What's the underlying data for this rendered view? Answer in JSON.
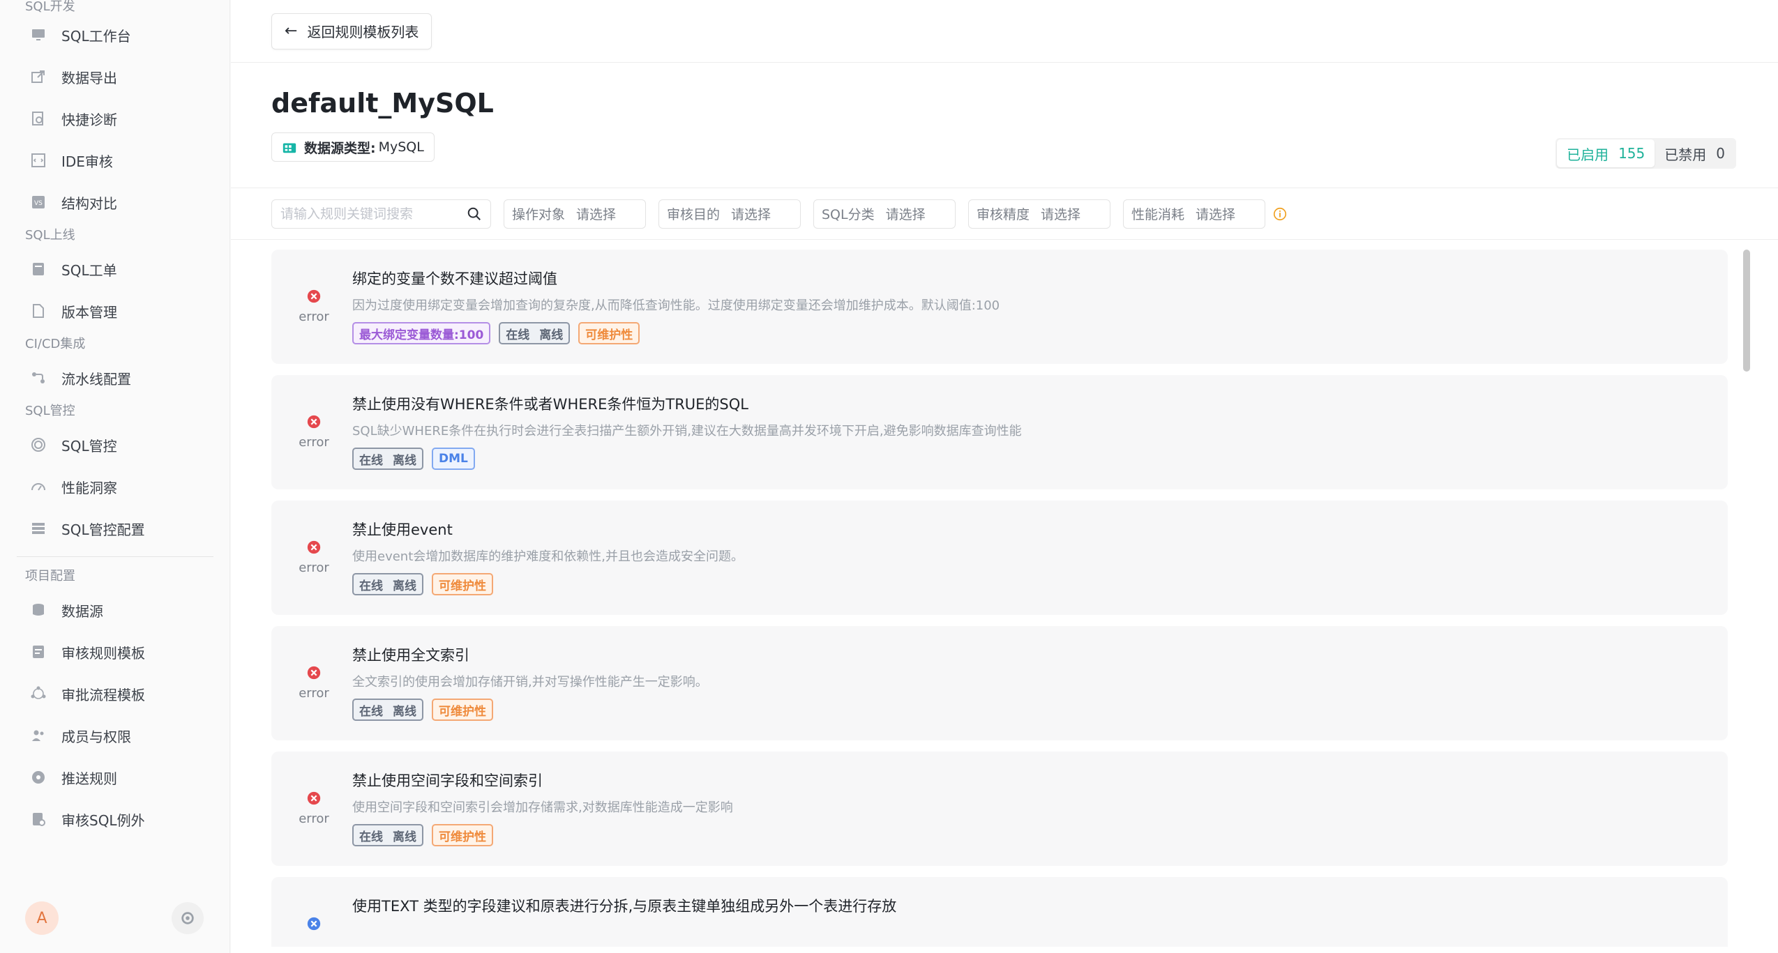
{
  "sidebar": {
    "groups": [
      {
        "title": "SQL开发",
        "items": [
          {
            "label": "SQL工作台",
            "icon": "monitor-icon"
          },
          {
            "label": "数据导出",
            "icon": "export-icon"
          },
          {
            "label": "快捷诊断",
            "icon": "diagnosis-icon"
          },
          {
            "label": "IDE审核",
            "icon": "ide-icon"
          },
          {
            "label": "结构对比",
            "icon": "compare-icon"
          }
        ]
      },
      {
        "title": "SQL上线",
        "items": [
          {
            "label": "SQL工单",
            "icon": "ticket-icon"
          },
          {
            "label": "版本管理",
            "icon": "version-icon"
          }
        ]
      },
      {
        "title": "CI/CD集成",
        "items": [
          {
            "label": "流水线配置",
            "icon": "pipeline-icon"
          }
        ]
      },
      {
        "title": "SQL管控",
        "items": [
          {
            "label": "SQL管控",
            "icon": "fingerprint-icon"
          },
          {
            "label": "性能洞察",
            "icon": "gauge-icon"
          },
          {
            "label": "SQL管控配置",
            "icon": "config-icon"
          }
        ]
      },
      {
        "title": "项目配置",
        "items": [
          {
            "label": "数据源",
            "icon": "database-icon"
          },
          {
            "label": "审核规则模板",
            "icon": "rule-template-icon"
          },
          {
            "label": "审批流程模板",
            "icon": "workflow-icon"
          },
          {
            "label": "成员与权限",
            "icon": "members-icon"
          },
          {
            "label": "推送规则",
            "icon": "push-icon"
          },
          {
            "label": "审核SQL例外",
            "icon": "exception-icon"
          }
        ]
      }
    ],
    "avatar_letter": "A"
  },
  "topbar": {
    "back_label": "返回规则模板列表"
  },
  "header": {
    "title": "default_MySQL",
    "db_type_label": "数据源类型:",
    "db_type_value": "MySQL",
    "enabled_label": "已启用",
    "enabled_count": "155",
    "disabled_label": "已禁用",
    "disabled_count": "0"
  },
  "filters": {
    "search_placeholder": "请输入规则关键词搜索",
    "selects": [
      {
        "label": "操作对象",
        "placeholder": "请选择"
      },
      {
        "label": "审核目的",
        "placeholder": "请选择"
      },
      {
        "label": "SQL分类",
        "placeholder": "请选择"
      },
      {
        "label": "审核精度",
        "placeholder": "请选择"
      },
      {
        "label": "性能消耗",
        "placeholder": "请选择"
      }
    ]
  },
  "rules": [
    {
      "level": "error",
      "title": "绑定的变量个数不建议超过阈值",
      "desc": "因为过度使用绑定变量会增加查询的复杂度,从而降低查询性能。过度使用绑定变量还会增加维护成本。默认阈值:100",
      "tags": [
        {
          "type": "purple",
          "text": "最大绑定变量数量:100"
        },
        {
          "type": "gray",
          "a": "在线",
          "b": "离线"
        },
        {
          "type": "orange",
          "text": "可维护性"
        }
      ]
    },
    {
      "level": "error",
      "title": "禁止使用没有WHERE条件或者WHERE条件恒为TRUE的SQL",
      "desc": "SQL缺少WHERE条件在执行时会进行全表扫描产生额外开销,建议在大数据量高并发环境下开启,避免影响数据库查询性能",
      "tags": [
        {
          "type": "gray",
          "a": "在线",
          "b": "离线"
        },
        {
          "type": "blue",
          "text": "DML"
        }
      ]
    },
    {
      "level": "error",
      "title": "禁止使用event",
      "desc": "使用event会增加数据库的维护难度和依赖性,并且也会造成安全问题。",
      "tags": [
        {
          "type": "gray",
          "a": "在线",
          "b": "离线"
        },
        {
          "type": "orange",
          "text": "可维护性"
        }
      ]
    },
    {
      "level": "error",
      "title": "禁止使用全文索引",
      "desc": "全文索引的使用会增加存储开销,并对写操作性能产生一定影响。",
      "tags": [
        {
          "type": "gray",
          "a": "在线",
          "b": "离线"
        },
        {
          "type": "orange",
          "text": "可维护性"
        }
      ]
    },
    {
      "level": "error",
      "title": "禁止使用空间字段和空间索引",
      "desc": "使用空间字段和空间索引会增加存储需求,对数据库性能造成一定影响",
      "tags": [
        {
          "type": "gray",
          "a": "在线",
          "b": "离线"
        },
        {
          "type": "orange",
          "text": "可维护性"
        }
      ]
    },
    {
      "level": "",
      "title": "使用TEXT 类型的字段建议和原表进行分拆,与原表主键单独组成另外一个表进行存放",
      "desc": "",
      "tags": []
    }
  ],
  "colors": {
    "accent": "#1fb29a",
    "error": "#e5484d",
    "warning": "#ef8a3b"
  }
}
